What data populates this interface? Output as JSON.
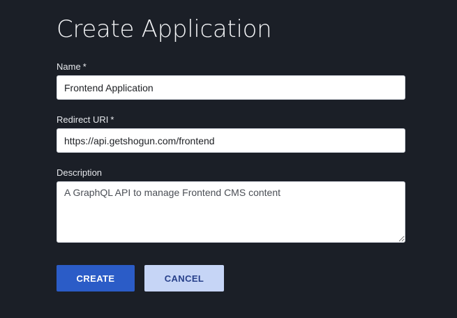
{
  "page": {
    "title": "Create Application"
  },
  "form": {
    "name": {
      "label": "Name",
      "required_marker": "*",
      "value": "Frontend Application"
    },
    "redirect_uri": {
      "label": "Redirect URI",
      "required_marker": "*",
      "value": "https://api.getshogun.com/frontend"
    },
    "description": {
      "label": "Description",
      "value": "A GraphQL API to manage Frontend CMS content"
    }
  },
  "actions": {
    "create_label": "CREATE",
    "cancel_label": "CANCEL"
  },
  "colors": {
    "background": "#1b1f27",
    "primary_button": "#2b5cc7",
    "secondary_button": "#c6d5f6",
    "secondary_button_text": "#27408a"
  }
}
